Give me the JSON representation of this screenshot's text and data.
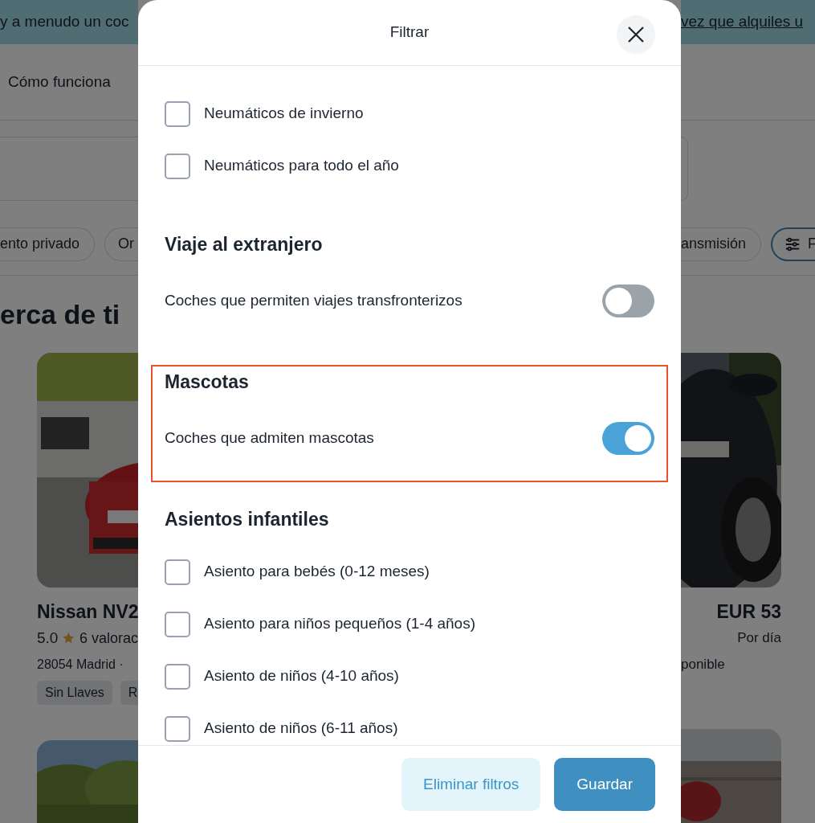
{
  "background": {
    "banner": {
      "text": "y a menudo un coc",
      "link": "vez que alquiles u"
    },
    "nav_link": "Cómo funciona",
    "chips": [
      {
        "label": "ento privado",
        "kind": "cut_start"
      },
      {
        "label": "Or",
        "kind": "cut_end"
      },
      {
        "label": "ansmisión",
        "kind": "cut_start"
      }
    ],
    "filter_button": {
      "label": "F"
    },
    "heading": "erca de ti",
    "cards": [
      {
        "title": "Nissan NV2",
        "rating": "5.0",
        "reviews": "6 valorac",
        "location": "28054 Madrid · ",
        "tags": [
          "Sin Llaves",
          "R"
        ]
      },
      {
        "price": "EUR 53",
        "price_unit": "Por día",
        "availability": "ponible"
      }
    ]
  },
  "modal": {
    "title": "Filtrar",
    "sections": [
      {
        "highlighted": false,
        "items": [
          {
            "kind": "checkbox",
            "label": "Neumáticos de invierno",
            "checked": false
          },
          {
            "kind": "checkbox",
            "label": "Neumáticos para todo el año",
            "checked": false
          }
        ]
      },
      {
        "heading": "Viaje al extranjero",
        "highlighted": false,
        "items": [
          {
            "kind": "toggle",
            "label": "Coches que permiten viajes transfronterizos",
            "on": false
          }
        ]
      },
      {
        "heading": "Mascotas",
        "highlighted": true,
        "items": [
          {
            "kind": "toggle",
            "label": "Coches que admiten mascotas",
            "on": true
          }
        ]
      },
      {
        "heading": "Asientos infantiles",
        "highlighted": false,
        "items": [
          {
            "kind": "checkbox",
            "label": "Asiento para bebés (0-12 meses)",
            "checked": false
          },
          {
            "kind": "checkbox",
            "label": "Asiento para niños pequeños (1-4 años)",
            "checked": false
          },
          {
            "kind": "checkbox",
            "label": "Asiento de niños (4-10 años)",
            "checked": false
          },
          {
            "kind": "checkbox",
            "label": "Asiento de niños (6-11 años)",
            "checked": false
          }
        ]
      }
    ],
    "buttons": [
      {
        "kind": "secondary",
        "label": "Eliminar filtros"
      },
      {
        "kind": "primary",
        "label": "Guardar"
      }
    ]
  }
}
